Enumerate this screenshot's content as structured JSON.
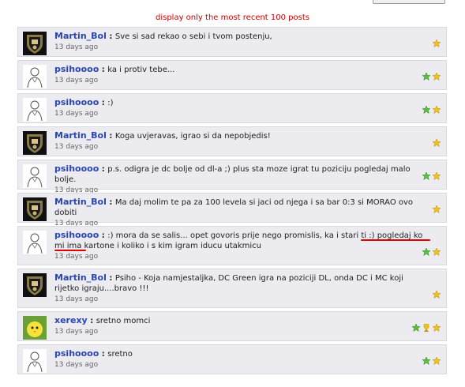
{
  "header": {
    "notice": "display only the most recent 100 posts"
  },
  "posts": [
    {
      "user": "Martin_Bol",
      "avatar": "team-crest",
      "text": "Sve si sad rekao o sebi i tvom postenju,",
      "time": "13 days ago",
      "badges": [
        "gold-star"
      ]
    },
    {
      "user": "psihoooo",
      "avatar": "sketch-figure",
      "text": "ka i protiv tebe...",
      "time": "13 days ago",
      "badges": [
        "green-star",
        "gold-star"
      ]
    },
    {
      "user": "psihoooo",
      "avatar": "sketch-figure",
      "text": ":)",
      "time": "13 days ago",
      "badges": [
        "green-star",
        "gold-star"
      ]
    },
    {
      "user": "Martin_Bol",
      "avatar": "team-crest",
      "text": "Koga uvjeravas, igrao si da nepobjedis!",
      "time": "13 days ago",
      "badges": [
        "gold-star"
      ]
    },
    {
      "user": "psihoooo",
      "avatar": "sketch-figure",
      "text": "p.s. odigra je dc bolje od dl-a ;) plus sta moze igrat tu poziciju pogledaj malo bolje.",
      "time": "13 days ago",
      "badges": [
        "green-star",
        "gold-star"
      ]
    },
    {
      "user": "Martin_Bol",
      "avatar": "team-crest",
      "text": "Ma daj molim te pa za 100 levela si jaci od njega i sa bar 0:3 si MORAO ovo dobiti",
      "time": "13 days ago",
      "badges": [
        "gold-star"
      ]
    },
    {
      "user": "psihoooo",
      "avatar": "sketch-figure",
      "text": ":) mora da se salis... opet govoris prije nego promislis, ka i stari ti :) pogledaj ko mi ima kartone i koliko i s kim igram iducu utakmicu",
      "time": "13 days ago",
      "badges": [
        "green-star",
        "gold-star"
      ]
    },
    {
      "user": "Martin_Bol",
      "avatar": "team-crest",
      "text": "Psiho - Koja namjestaljka, DC Green igra na poziciji DL, onda DC i MC koji rijetko igraju....bravo !!!",
      "time": "13 days ago",
      "badges": [
        "gold-star"
      ]
    },
    {
      "user": "xerexy",
      "avatar": "yellow-chick",
      "text": "sretno momci",
      "time": "13 days ago",
      "badges": [
        "green-star",
        "gold-trophy",
        "gold-star"
      ]
    },
    {
      "user": "psihoooo",
      "avatar": "sketch-figure",
      "text": "sretno",
      "time": "13 days ago",
      "badges": [
        "green-star",
        "gold-star"
      ]
    }
  ],
  "colors": {
    "username": "#2a46b3",
    "notice": "#cc0000",
    "post_bg": "#ebebf0",
    "underline": "#e00000"
  }
}
